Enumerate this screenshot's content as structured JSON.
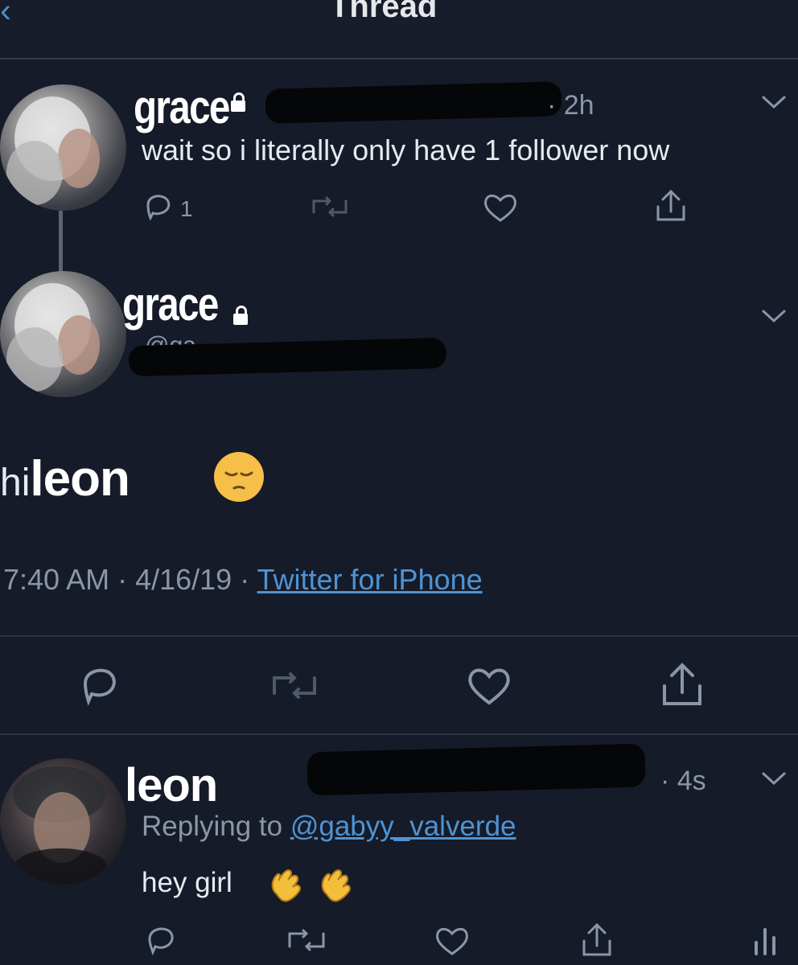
{
  "header": {
    "title": "Thread",
    "back_symbol": "‹"
  },
  "tweet1": {
    "name": "grace",
    "time": "· 2h",
    "text": "wait so i literally only have 1 follower now",
    "reply_count": "1"
  },
  "tweet2": {
    "name": "grace",
    "handle_partial": "@ga",
    "text_prefix": "hi ",
    "text_emphasis": "leon",
    "timestamp": "7:40 AM · 4/16/19 · ",
    "source": "Twitter for iPhone"
  },
  "tweet3": {
    "name": "leon",
    "time": "· 4s",
    "replying_prefix": "Replying to ",
    "replying_handle": "@gabyy_valverde",
    "text": "hey girl"
  },
  "colors": {
    "background": "#151b28",
    "accent": "#4e93d4",
    "muted": "#8b96a6"
  },
  "icons": [
    "back-icon",
    "chevron-down-icon",
    "reply-icon",
    "retweet-icon",
    "like-icon",
    "share-icon",
    "analytics-icon",
    "lock-icon"
  ]
}
